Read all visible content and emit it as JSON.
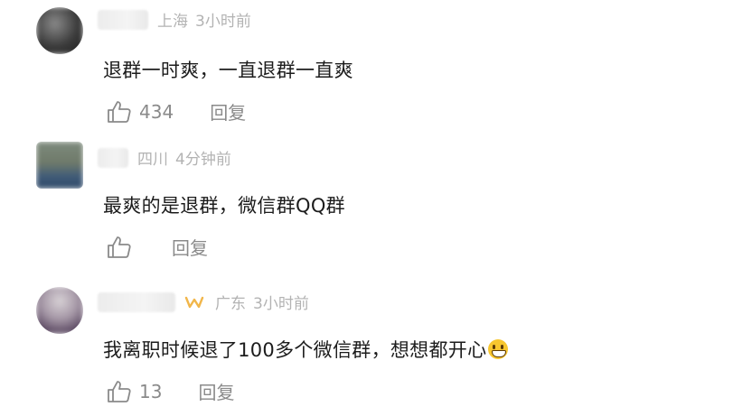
{
  "comments": [
    {
      "location": "上海",
      "time": "3小时前",
      "text": "退群一时爽，一直退群一直爽",
      "likes": "434",
      "reply_label": "回复",
      "verified_badge": false
    },
    {
      "location": "四川",
      "time": "4分钟前",
      "text": "最爽的是退群，微信群QQ群",
      "likes": "",
      "reply_label": "回复",
      "verified_badge": false
    },
    {
      "location": "广东",
      "time": "3小时前",
      "text": "我离职时候退了100多个微信群，想想都开心",
      "emoji": "grin-emoji",
      "likes": "13",
      "reply_label": "回复",
      "verified_badge": true
    }
  ],
  "colors": {
    "meta_text": "#b3b3b3",
    "body_text": "#1c1c1c",
    "action_text": "#8a8a8a",
    "badge": "#f1b64a"
  },
  "icons": [
    "thumb-up-icon",
    "verified-badge-icon",
    "grin-emoji"
  ]
}
